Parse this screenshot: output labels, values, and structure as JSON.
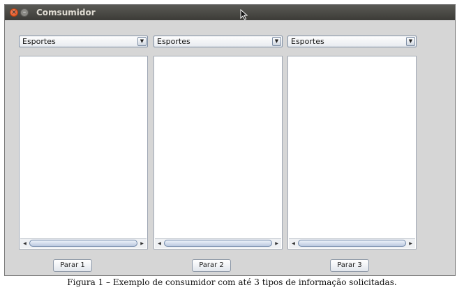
{
  "window": {
    "title": "Comsumidor",
    "close_glyph": "×",
    "minimize_glyph": "–"
  },
  "columns": [
    {
      "combo_value": "Esportes",
      "stop_label": "Parar 1"
    },
    {
      "combo_value": "Esportes",
      "stop_label": "Parar 2"
    },
    {
      "combo_value": "Esportes",
      "stop_label": "Parar 3"
    }
  ],
  "icons": {
    "dropdown": "▼",
    "scroll_left": "◀",
    "scroll_right": "▶"
  },
  "caption": "Figura 1 – Exemplo de consumidor com até 3 tipos de informação solicitadas."
}
